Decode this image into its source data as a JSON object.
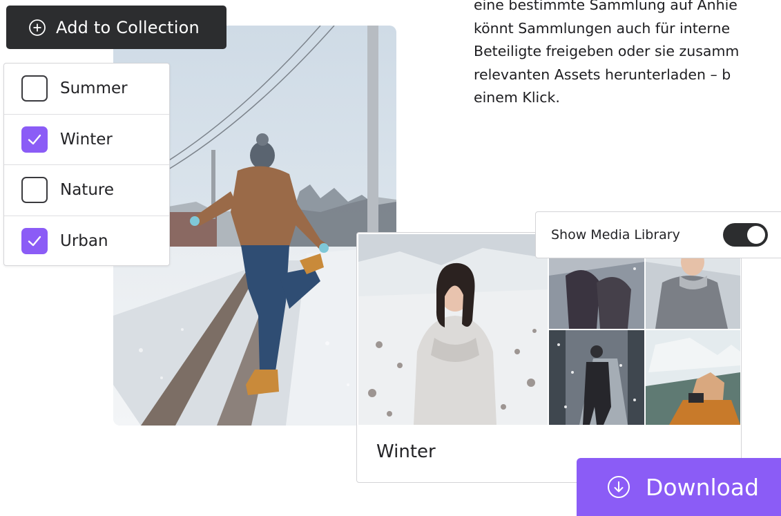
{
  "paragraph": {
    "lines": [
      "eine bestimmte Sammlung auf Anhie",
      "könnt Sammlungen auch für interne",
      "Beteiligte freigeben oder sie zusamm",
      "relevanten Assets herunterladen – b",
      "einem Klick."
    ]
  },
  "add_button": {
    "label": "Add to Collection",
    "icon": "plus-circle-icon"
  },
  "collections": {
    "items": [
      {
        "label": "Summer",
        "checked": false
      },
      {
        "label": "Winter",
        "checked": true
      },
      {
        "label": "Nature",
        "checked": false
      },
      {
        "label": "Urban",
        "checked": true
      }
    ]
  },
  "toggle": {
    "label": "Show Media Library",
    "on": true
  },
  "card": {
    "title": "Winter"
  },
  "download": {
    "label": "Download",
    "icon": "download-circle-icon"
  },
  "colors": {
    "accent": "#8b5cf6",
    "dark": "#2c2d2f",
    "border": "#d3d3d6"
  }
}
